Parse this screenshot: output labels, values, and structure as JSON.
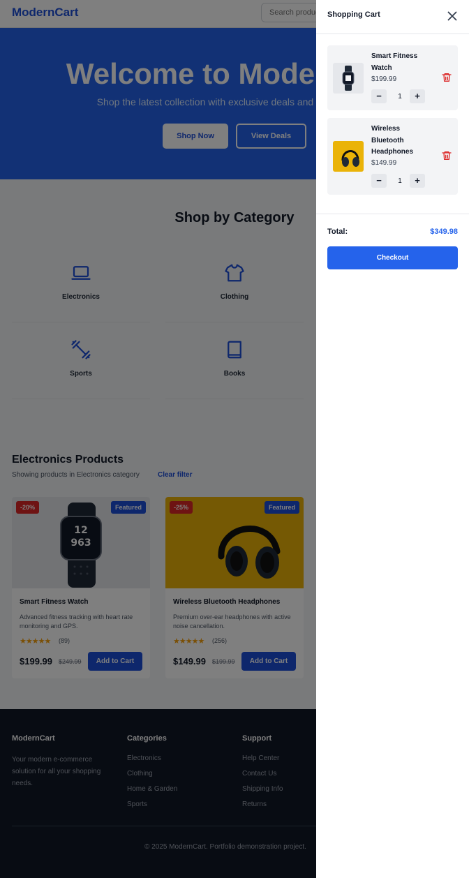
{
  "header": {
    "logo": "ModernCart",
    "search_placeholder": "Search products..."
  },
  "hero": {
    "title": "Welcome to ModernCart",
    "subtitle": "Shop the latest collection with exclusive deals and free shipping",
    "shop_now": "Shop Now",
    "view_deals": "View Deals"
  },
  "categories": {
    "title": "Shop by Category",
    "items": [
      {
        "label": "Electronics",
        "icon": "laptop-icon"
      },
      {
        "label": "Clothing",
        "icon": "shirt-icon"
      },
      {
        "label": "Sports",
        "icon": "dumbbell-icon"
      },
      {
        "label": "Books",
        "icon": "book-icon"
      }
    ]
  },
  "products": {
    "heading": "Electronics Products",
    "info": "Showing products in Electronics category",
    "clear_filter": "Clear filter",
    "items": [
      {
        "discount": "-20%",
        "featured": "Featured",
        "name": "Smart Fitness Watch",
        "desc": "Advanced fitness tracking with heart rate monitoring and GPS.",
        "rating": "★★★★★",
        "reviews": "(89)",
        "price": "$199.99",
        "old_price": "$249.99",
        "button": "Add to Cart"
      },
      {
        "discount": "-25%",
        "featured": "Featured",
        "name": "Wireless Bluetooth Headphones",
        "desc": "Premium over-ear headphones with active noise cancellation.",
        "rating": "★★★★★",
        "reviews": "(256)",
        "price": "$149.99",
        "old_price": "$199.99",
        "button": "Add to Cart"
      }
    ]
  },
  "footer": {
    "brand": "ModernCart",
    "brand_text": "Your modern e-commerce solution for all your shopping needs.",
    "categories_title": "Categories",
    "categories": [
      "Electronics",
      "Clothing",
      "Home & Garden",
      "Sports"
    ],
    "support_title": "Support",
    "support": [
      "Help Center",
      "Contact Us",
      "Shipping Info",
      "Returns"
    ],
    "copyright": "© 2025 ModernCart. Portfolio demonstration project."
  },
  "cart": {
    "title": "Shopping Cart",
    "items": [
      {
        "name": "Smart Fitness Watch",
        "price": "$199.99",
        "qty": "1"
      },
      {
        "name": "Wireless Bluetooth Headphones",
        "price": "$149.99",
        "qty": "1"
      }
    ],
    "total_label": "Total:",
    "total_value": "$349.98",
    "checkout": "Checkout"
  },
  "colors": {
    "accent": "#2563eb",
    "danger": "#dc2626",
    "footer_bg": "#111827"
  }
}
